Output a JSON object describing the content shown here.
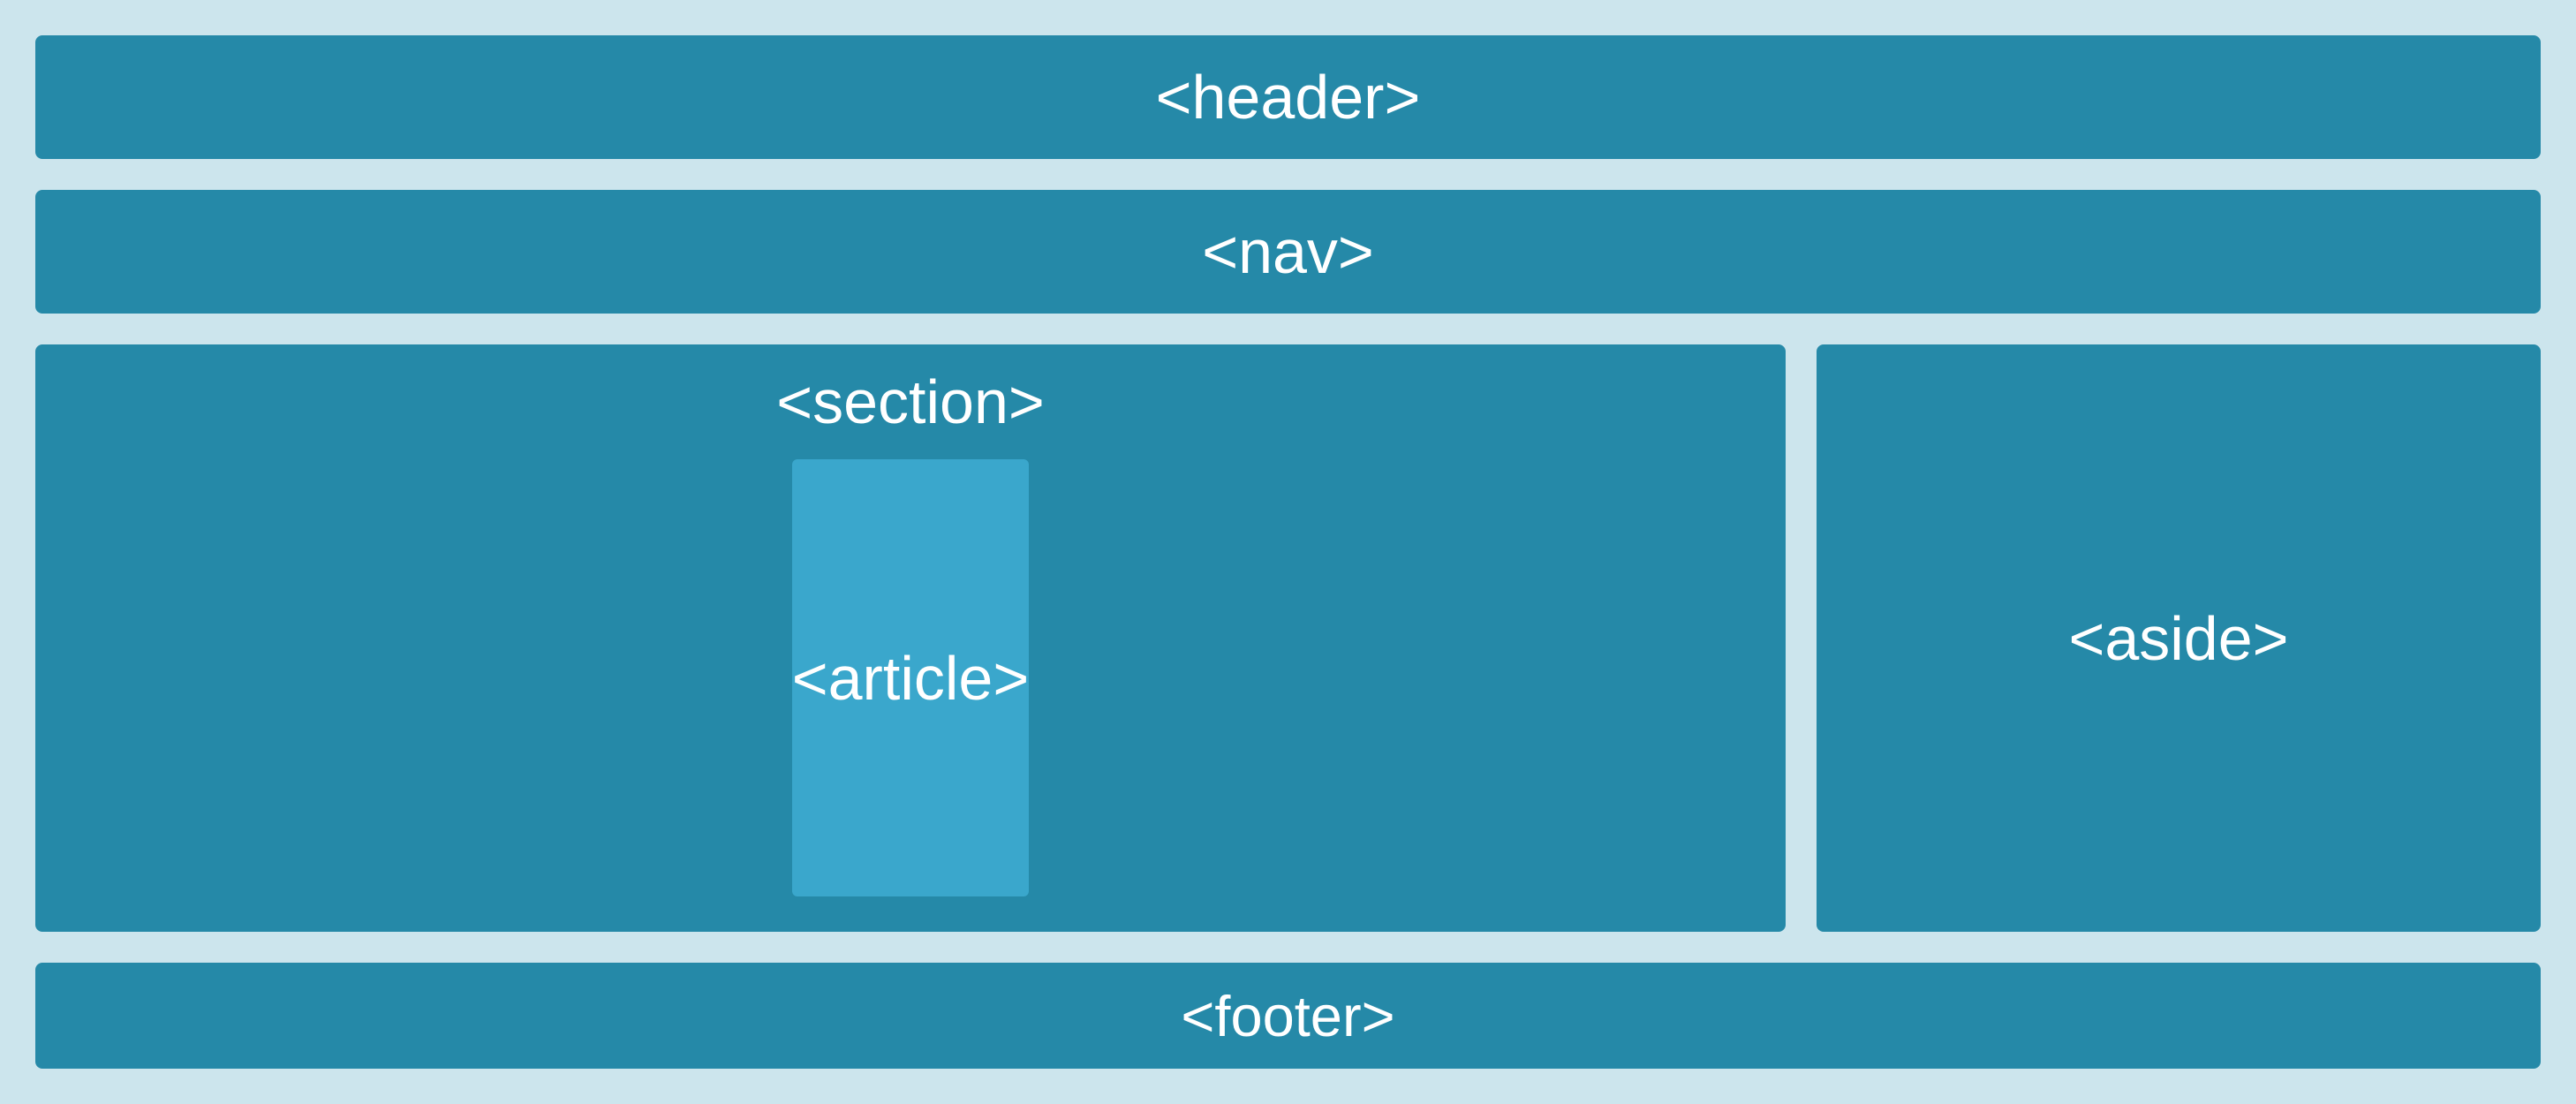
{
  "layout": {
    "header": "<header>",
    "nav": "<nav>",
    "section": "<section>",
    "article": "<article>",
    "aside": "<aside>",
    "footer": "<footer>"
  },
  "colors": {
    "background": "#cce5ed",
    "block": "#2589a8",
    "article": "#3aa7cc",
    "text": "#ffffff"
  }
}
